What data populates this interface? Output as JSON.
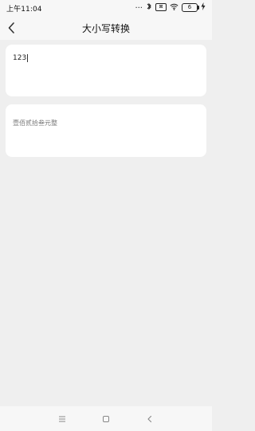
{
  "status_bar": {
    "time": "上午11:04",
    "dots": "...",
    "sim_label": "⊠",
    "battery_level": "6"
  },
  "nav": {
    "title": "大小写转换"
  },
  "converter": {
    "input_value": "123",
    "output_value": "壹佰贰拾叁元整"
  },
  "icons": {
    "back": "chevron-left-icon",
    "menu": "menu-lines-icon",
    "home": "square-home-icon",
    "system_back": "chevron-left-icon"
  },
  "colors": {
    "page_background": "#efefef",
    "card_background": "#ffffff",
    "bar_background": "#f7f7f7"
  }
}
